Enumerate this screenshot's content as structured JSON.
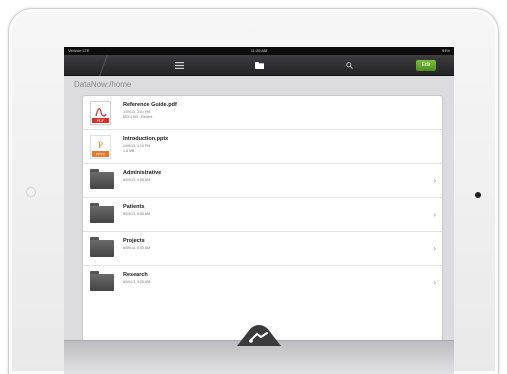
{
  "status_bar": {
    "carrier": "Verizon LTE",
    "time": "11:20 AM",
    "battery": "94%"
  },
  "nav": {
    "edit_label": "Edit"
  },
  "path": "DataNow:/home",
  "files": [
    {
      "name": "Reference Guide.pdf",
      "date": "1/09/13, 3:01 PM",
      "detail": "603.4 KB · Recent",
      "kind": "pdf",
      "badge": "PDF"
    },
    {
      "name": "Introduction.pptx",
      "date": "1/09/13, 3:10 PM",
      "detail": "1.8 MB",
      "kind": "pptx",
      "badge": "PPTX"
    }
  ],
  "folders": [
    {
      "name": "Administrative",
      "date": "8/09/13, 9:55 AM"
    },
    {
      "name": "Patients",
      "date": "8/09/13, 9:55 AM"
    },
    {
      "name": "Projects",
      "date": "8/09/13, 9:55 AM"
    },
    {
      "name": "Research",
      "date": "8/09/13, 9:55 AM"
    }
  ],
  "colors": {
    "accent_green": "#5fa42a",
    "pdf_red": "#d42f28",
    "pptx_orange": "#e8792a"
  },
  "icons": {
    "list_tab": "list-icon",
    "folder_tab": "folder-icon",
    "search_tab": "search-icon",
    "chevron": "chevron-right-icon",
    "handle": "logo-handle-icon"
  }
}
